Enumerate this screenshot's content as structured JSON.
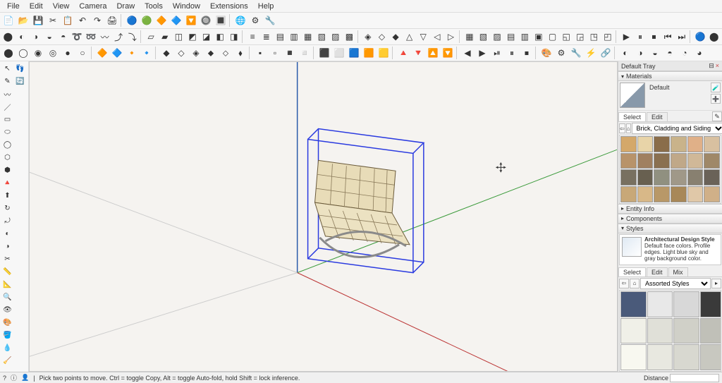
{
  "menu": {
    "items": [
      "File",
      "Edit",
      "View",
      "Camera",
      "Draw",
      "Tools",
      "Window",
      "Extensions",
      "Help"
    ]
  },
  "toolbars": {
    "row1": [
      "📄",
      "📂",
      "💾",
      "✂",
      "📋",
      "↶",
      "↷",
      "🖨",
      "|",
      "🔵",
      "🟢",
      "🔶",
      "🔷",
      "🔽",
      "🔘",
      "🔳",
      "|",
      "🌐",
      "⚙",
      "🔧"
    ],
    "row2": [
      "⬤",
      "◐",
      "◑",
      "◒",
      "◓",
      "➰",
      "➿",
      "〰",
      "⤴",
      "⤵",
      "|",
      "▱",
      "▰",
      "◫",
      "◩",
      "◪",
      "◧",
      "◨",
      "|",
      "≡",
      "≣",
      "▤",
      "▥",
      "▦",
      "▧",
      "▨",
      "▩",
      "|",
      "◈",
      "◇",
      "◆",
      "△",
      "▽",
      "◁",
      "▷",
      "|",
      "▦",
      "▧",
      "▨",
      "▤",
      "▥",
      "▣",
      "▢",
      "◱",
      "◲",
      "◳",
      "◰",
      "|",
      "▶",
      "⏸",
      "⏹",
      "⏮",
      "⏭",
      "|",
      "🔵",
      "⬤"
    ],
    "row3": [
      "⬤",
      "◯",
      "◉",
      "◎",
      "●",
      "○",
      "|",
      "🔶",
      "🔷",
      "🔸",
      "🔹",
      "|",
      "◆",
      "◇",
      "◈",
      "⬥",
      "⬦",
      "⬧",
      "|",
      "▪",
      "▫",
      "◾",
      "◽",
      "|",
      "⬛",
      "⬜",
      "🟦",
      "🟧",
      "🟨",
      "|",
      "🔺",
      "🔻",
      "🔼",
      "🔽",
      "|",
      "◀",
      "▶",
      "⏯",
      "⏸",
      "⏹",
      "|",
      "🎨",
      "⚙",
      "🔧",
      "⚡",
      "🔗",
      "|",
      "◐",
      "◑",
      "◒",
      "◓",
      "◔",
      "◕"
    ],
    "row4": [
      "⊙",
      "⊚",
      "⊛",
      "|",
      "▣",
      "▤",
      "▥",
      "▦",
      "▧",
      "▨",
      "▩",
      "|",
      "◈",
      "◇",
      "◆",
      "|",
      "⬡",
      "⬢",
      "⬣",
      "|",
      "✦",
      "✧",
      "✶",
      "✷",
      "✸",
      "|",
      "⊞",
      "⊟",
      "⊠",
      "⊡",
      "|",
      "━",
      "┃",
      "╋"
    ]
  },
  "leftTools": [
    "↖",
    "✎",
    "〰",
    "／",
    "▭",
    "⬭",
    "◯",
    "⬡",
    "⬢",
    "🔺",
    "⬆",
    "↻",
    "⤾",
    "◐",
    "◑",
    "✂",
    "📏",
    "📐",
    "🔍",
    "👁",
    "🎨",
    "🪣",
    "💧",
    "🧹",
    "👣",
    "🔄"
  ],
  "tray": {
    "title": "Default Tray",
    "materials": {
      "title": "Materials",
      "current": "Default",
      "tabs": [
        "Select",
        "Edit"
      ],
      "activeTab": "Select",
      "collection": "Brick, Cladding and Siding",
      "swatches": [
        "#d4a86a",
        "#e8d4a8",
        "#8a6d4a",
        "#c9b38a",
        "#e0b088",
        "#d8c0a0",
        "#b8936a",
        "#a08060",
        "#8a7050",
        "#c0a888",
        "#d0b898",
        "#9f8868",
        "#787060",
        "#686050",
        "#909080",
        "#a09888",
        "#888070",
        "#6a6258",
        "#c8a878",
        "#d8b888",
        "#b89868",
        "#a88858",
        "#e0c8a8",
        "#d0b088"
      ]
    },
    "entityInfo": {
      "title": "Entity Info"
    },
    "components": {
      "title": "Components"
    },
    "styles": {
      "title": "Styles",
      "name": "Architectural Design Style",
      "desc": "Default face colors. Profile edges. Light blue sky and gray background color.",
      "tabs": [
        "Select",
        "Edit",
        "Mix"
      ],
      "activeTab": "Select",
      "collection": "Assorted Styles",
      "swatches": [
        "#4a5a7a",
        "#e8e8e8",
        "#d8d8d8",
        "#3a3a3a",
        "#c8c8c8",
        "#f0f0e8",
        "#e0e0d8",
        "#d0d0c8",
        "#c0c0b8",
        "#b8b8b0",
        "#f8f8f0",
        "#e8e8e0",
        "#d8d8d0",
        "#c8c8c0",
        "#b0b0a8"
      ]
    }
  },
  "status": {
    "hint": "Pick two points to move.  Ctrl = toggle Copy, Alt = toggle Auto-fold, hold Shift = lock inference.",
    "distanceLabel": "Distance",
    "distanceValue": ""
  }
}
